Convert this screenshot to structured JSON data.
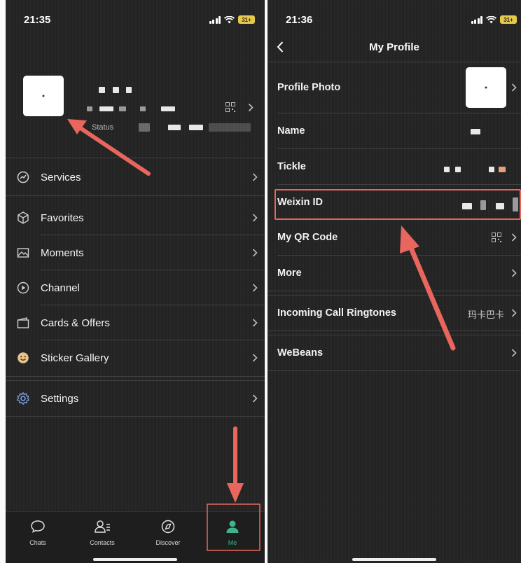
{
  "left_screen": {
    "status_bar": {
      "time": "21:35",
      "battery": "31+"
    },
    "profile": {
      "status_label": "Status"
    },
    "menu": [
      {
        "label": "Services",
        "icon": "services-icon"
      },
      {
        "label": "Favorites",
        "icon": "cube-icon"
      },
      {
        "label": "Moments",
        "icon": "image-icon"
      },
      {
        "label": "Channel",
        "icon": "play-circle-icon"
      },
      {
        "label": "Cards & Offers",
        "icon": "wallet-icon"
      },
      {
        "label": "Sticker Gallery",
        "icon": "smiley-icon"
      },
      {
        "label": "Settings",
        "icon": "gear-icon"
      }
    ],
    "tabbar": [
      {
        "label": "Chats",
        "icon": "chat-bubble-icon"
      },
      {
        "label": "Contacts",
        "icon": "contacts-icon"
      },
      {
        "label": "Discover",
        "icon": "compass-icon"
      },
      {
        "label": "Me",
        "icon": "person-icon",
        "selected": true
      }
    ],
    "accent_color": "#3fb389"
  },
  "right_screen": {
    "status_bar": {
      "time": "21:36",
      "battery": "31+"
    },
    "nav_title": "My Profile",
    "rows": [
      {
        "label": "Profile Photo"
      },
      {
        "label": "Name"
      },
      {
        "label": "Tickle"
      },
      {
        "label": "Weixin ID",
        "highlighted": true
      },
      {
        "label": "My QR Code"
      },
      {
        "label": "More"
      },
      {
        "label": "Incoming Call Ringtones",
        "value": "玛卡巴卡"
      },
      {
        "label": "WeBeans"
      }
    ]
  },
  "annotation_color": "#e8665e"
}
